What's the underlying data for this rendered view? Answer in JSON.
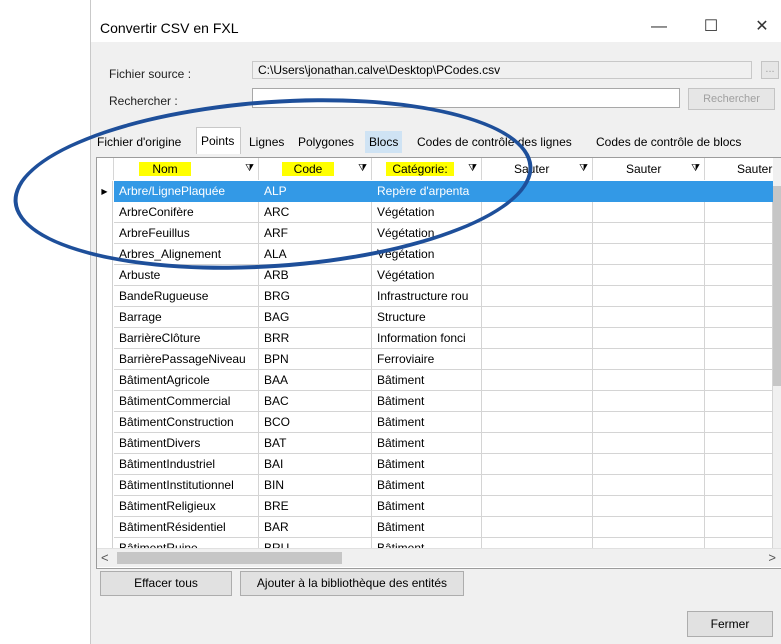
{
  "window": {
    "title": "Convertir CSV en FXL",
    "minimize": "—",
    "maximize": "☐",
    "close": "✕"
  },
  "form": {
    "source_label": "Fichier source :",
    "source_value": "C:\\Users\\jonathan.calve\\Desktop\\PCodes.csv",
    "browse_label": "...",
    "search_label": "Rechercher :",
    "search_value": "",
    "search_button": "Rechercher"
  },
  "tabs": [
    "Fichier d'origine",
    "Points",
    "Lignes",
    "Polygones",
    "Blocs",
    "Codes de contrôle des lignes",
    "Codes de contrôle de blocs"
  ],
  "active_tab": "Points",
  "columns": [
    "Nom",
    "Code",
    "Catégorie:",
    "Sauter",
    "Sauter",
    "Sauter"
  ],
  "rows": [
    [
      "Arbre/LignePlaquée",
      "ALP",
      "Repère d'arpenta"
    ],
    [
      "ArbreConifère",
      "ARC",
      "Végétation"
    ],
    [
      "ArbreFeuillus",
      "ARF",
      "Végétation"
    ],
    [
      "Arbres_Alignement",
      "ALA",
      "Végétation"
    ],
    [
      "Arbuste",
      "ARB",
      "Végétation"
    ],
    [
      "BandeRugueuse",
      "BRG",
      "Infrastructure rou"
    ],
    [
      "Barrage",
      "BAG",
      "Structure"
    ],
    [
      "BarrièreClôture",
      "BRR",
      "Information fonci"
    ],
    [
      "BarrièrePassageNiveau",
      "BPN",
      "Ferroviaire"
    ],
    [
      "BâtimentAgricole",
      "BAA",
      "Bâtiment"
    ],
    [
      "BâtimentCommercial",
      "BAC",
      "Bâtiment"
    ],
    [
      "BâtimentConstruction",
      "BCO",
      "Bâtiment"
    ],
    [
      "BâtimentDivers",
      "BAT",
      "Bâtiment"
    ],
    [
      "BâtimentIndustriel",
      "BAI",
      "Bâtiment"
    ],
    [
      "BâtimentInstitutionnel",
      "BIN",
      "Bâtiment"
    ],
    [
      "BâtimentReligieux",
      "BRE",
      "Bâtiment"
    ],
    [
      "BâtimentRésidentiel",
      "BAR",
      "Bâtiment"
    ],
    [
      "BâtimentRuine",
      "BRU",
      "Bâtiment"
    ]
  ],
  "scroll": {
    "left": "<",
    "right": ">"
  },
  "buttons": {
    "clear": "Effacer tous",
    "add": "Ajouter à la bibliothèque des entités",
    "close": "Fermer"
  },
  "colors": {
    "selection": "#3399e6",
    "highlight": "#ffff00",
    "annotation": "#1e4f9a"
  }
}
